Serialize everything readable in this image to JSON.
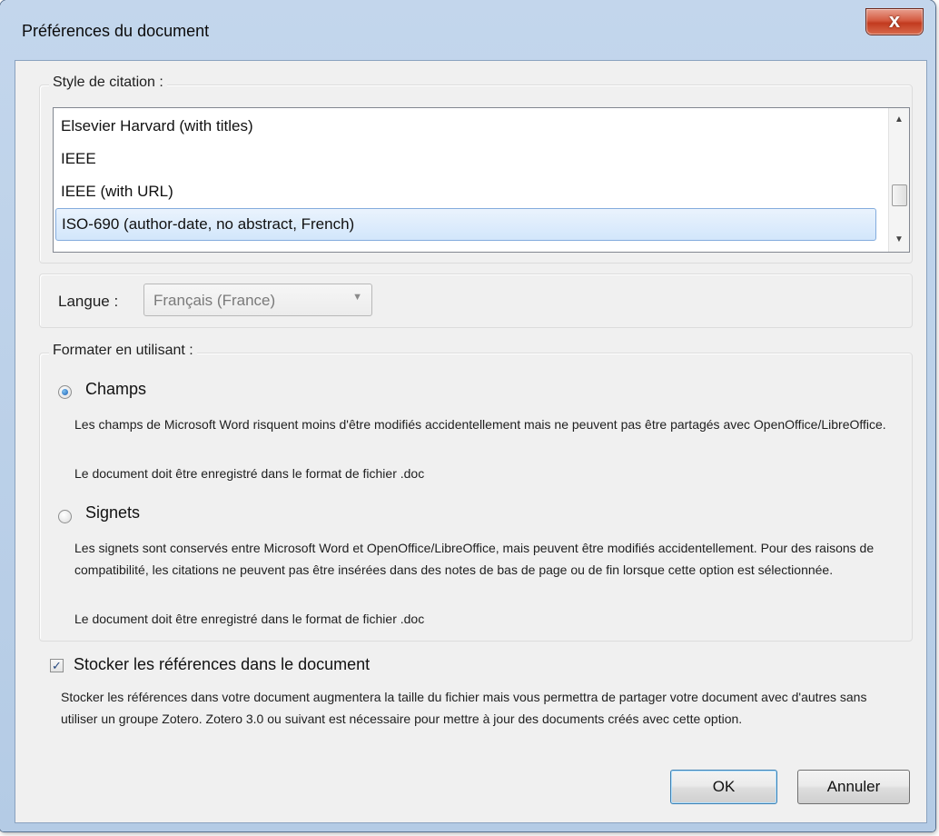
{
  "window": {
    "title": "Préférences du document",
    "close_glyph": "x"
  },
  "citation_style": {
    "legend": "Style de citation :",
    "items": [
      "Elsevier Harvard (with titles)",
      "IEEE",
      "IEEE (with URL)",
      "ISO-690 (author-date, no abstract, French)"
    ],
    "selected_index": 3,
    "scroll_up": "▲",
    "scroll_down": "▼"
  },
  "language": {
    "label": "Langue :",
    "value": "Français (France)",
    "arrow": "▼"
  },
  "format": {
    "legend": "Formater en utilisant :",
    "fields": {
      "label": "Champs",
      "checked": true,
      "desc1": "Les champs de Microsoft Word risquent moins d'être modifiés accidentellement mais ne peuvent pas être partagés avec OpenOffice/LibreOffice.",
      "desc2": "Le document doit être enregistré dans le format de fichier .doc"
    },
    "bookmarks": {
      "label": "Signets",
      "checked": false,
      "desc1": "Les signets sont conservés entre Microsoft Word et OpenOffice/LibreOffice, mais peuvent être modifiés accidentellement. Pour des raisons de compatibilité, les citations ne peuvent pas être insérées dans des notes de bas de page ou de fin lorsque cette option est sélectionnée.",
      "desc2": "Le document doit être enregistré dans le format de fichier .doc"
    }
  },
  "store_refs": {
    "label": "Stocker les références dans le document",
    "checked": true,
    "check_glyph": "✓",
    "desc": "Stocker les références dans votre document augmentera la taille du fichier mais vous permettra de partager votre document avec d'autres sans utiliser un groupe Zotero. Zotero 3.0 ou suivant est nécessaire pour mettre à jour des documents créés avec cette option."
  },
  "buttons": {
    "ok": "OK",
    "cancel": "Annuler"
  }
}
